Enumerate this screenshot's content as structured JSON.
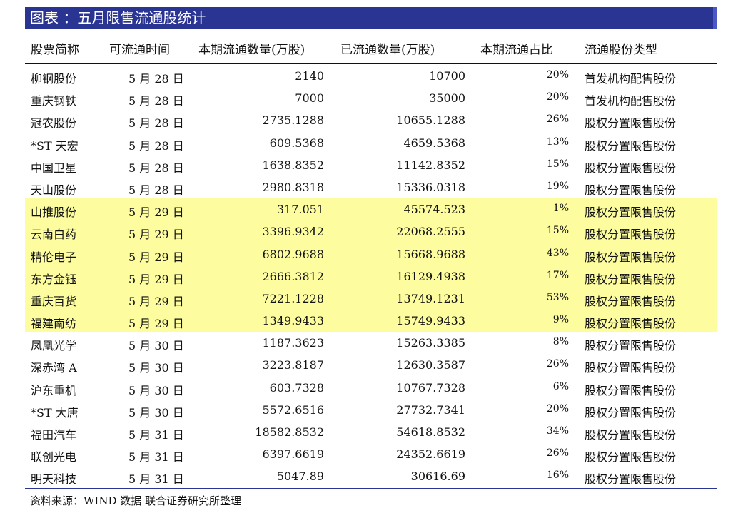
{
  "title": "图表 ：五月限售流通股统计",
  "headers": {
    "name": "股票简称",
    "date": "可流通时间",
    "current": "本期流通数量(万股)",
    "circulated": "已流通数量(万股)",
    "ratio": "本期流通占比",
    "type": "流通股份类型"
  },
  "highlight_color": "#fdfd9f",
  "rows": [
    {
      "name": "柳钢股份",
      "date": "5 月 28 日",
      "current": "2140",
      "circulated": "10700",
      "ratio": "20%",
      "type": "首发机构配售股份",
      "highlight": false
    },
    {
      "name": "重庆钢铁",
      "date": "5 月 28 日",
      "current": "7000",
      "circulated": "35000",
      "ratio": "20%",
      "type": "首发机构配售股份",
      "highlight": false
    },
    {
      "name": "冠农股份",
      "date": "5 月 28 日",
      "current": "2735.1288",
      "circulated": "10655.1288",
      "ratio": "26%",
      "type": "股权分置限售股份",
      "highlight": false
    },
    {
      "name": "*ST 天宏",
      "date": "5 月 28 日",
      "current": "609.5368",
      "circulated": "4659.5368",
      "ratio": "13%",
      "type": "股权分置限售股份",
      "highlight": false
    },
    {
      "name": "中国卫星",
      "date": "5 月 28 日",
      "current": "1638.8352",
      "circulated": "11142.8352",
      "ratio": "15%",
      "type": "股权分置限售股份",
      "highlight": false
    },
    {
      "name": "天山股份",
      "date": "5 月 28 日",
      "current": "2980.8318",
      "circulated": "15336.0318",
      "ratio": "19%",
      "type": "股权分置限售股份",
      "highlight": false
    },
    {
      "name": "山推股份",
      "date": "5 月 29 日",
      "current": "317.051",
      "circulated": "45574.523",
      "ratio": "1%",
      "type": "股权分置限售股份",
      "highlight": true
    },
    {
      "name": "云南白药",
      "date": "5 月 29 日",
      "current": "3396.9342",
      "circulated": "22068.2555",
      "ratio": "15%",
      "type": "股权分置限售股份",
      "highlight": true
    },
    {
      "name": "精伦电子",
      "date": "5 月 29 日",
      "current": "6802.9688",
      "circulated": "15668.9688",
      "ratio": "43%",
      "type": "股权分置限售股份",
      "highlight": true
    },
    {
      "name": "东方金钰",
      "date": "5 月 29 日",
      "current": "2666.3812",
      "circulated": "16129.4938",
      "ratio": "17%",
      "type": "股权分置限售股份",
      "highlight": true
    },
    {
      "name": "重庆百货",
      "date": "5 月 29 日",
      "current": "7221.1228",
      "circulated": "13749.1231",
      "ratio": "53%",
      "type": "股权分置限售股份",
      "highlight": true
    },
    {
      "name": "福建南纺",
      "date": "5 月 29 日",
      "current": "1349.9433",
      "circulated": "15749.9433",
      "ratio": "9%",
      "type": "股权分置限售股份",
      "highlight": true
    },
    {
      "name": "凤凰光学",
      "date": "5 月 30 日",
      "current": "1187.3623",
      "circulated": "15263.3385",
      "ratio": "8%",
      "type": "股权分置限售股份",
      "highlight": false
    },
    {
      "name": "深赤湾 A",
      "date": "5 月 30 日",
      "current": "3223.8187",
      "circulated": "12630.3587",
      "ratio": "26%",
      "type": "股权分置限售股份",
      "highlight": false
    },
    {
      "name": "沪东重机",
      "date": "5 月 30 日",
      "current": "603.7328",
      "circulated": "10767.7328",
      "ratio": "6%",
      "type": "股权分置限售股份",
      "highlight": false
    },
    {
      "name": "*ST 大唐",
      "date": "5 月 30 日",
      "current": "5572.6516",
      "circulated": "27732.7341",
      "ratio": "20%",
      "type": "股权分置限售股份",
      "highlight": false
    },
    {
      "name": "福田汽车",
      "date": "5 月 31 日",
      "current": "18582.8532",
      "circulated": "54618.8532",
      "ratio": "34%",
      "type": "股权分置限售股份",
      "highlight": false
    },
    {
      "name": "联创光电",
      "date": "5 月 31 日",
      "current": "6397.6619",
      "circulated": "24352.6619",
      "ratio": "26%",
      "type": "股权分置限售股份",
      "highlight": false
    },
    {
      "name": "明天科技",
      "date": "5 月 31 日",
      "current": "5047.89",
      "circulated": "30616.69",
      "ratio": "16%",
      "type": "股权分置限售股份",
      "highlight": false
    }
  ],
  "source": "资料来源：WIND 数据   联合证券研究所整理"
}
